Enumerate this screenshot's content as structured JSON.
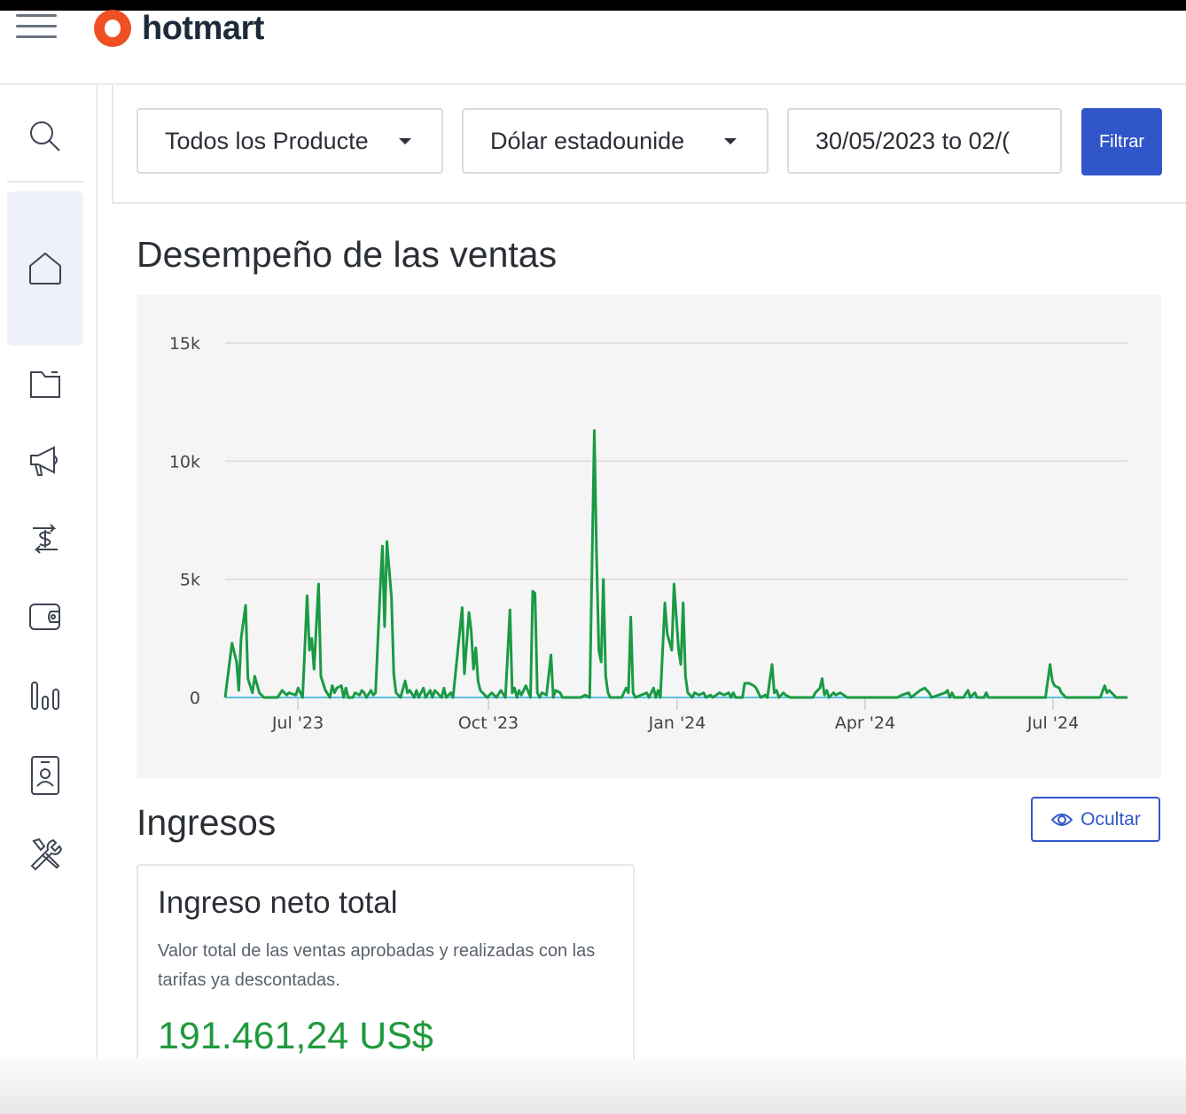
{
  "header": {
    "logo_text": "hotmart"
  },
  "sidebar": {
    "items": [
      {
        "name": "search",
        "icon": "search-icon"
      },
      {
        "name": "home",
        "icon": "home-icon",
        "active": true
      },
      {
        "name": "products",
        "icon": "folder-icon"
      },
      {
        "name": "marketing",
        "icon": "megaphone-icon"
      },
      {
        "name": "sales",
        "icon": "dollar-exchange-icon"
      },
      {
        "name": "wallet",
        "icon": "wallet-icon"
      },
      {
        "name": "analytics",
        "icon": "bar-chart-icon"
      },
      {
        "name": "contacts",
        "icon": "contact-card-icon"
      },
      {
        "name": "tools",
        "icon": "tools-icon"
      }
    ]
  },
  "filters": {
    "product_select": "Todos los Productе",
    "currency_select": "Dólar estadounide",
    "date_range": "30/05/2023 to 02/(",
    "filter_button": "Filtrar"
  },
  "sales_section": {
    "title": "Desempeño de las ventas"
  },
  "chart_data": {
    "type": "line",
    "y_tick_labels": [
      "0",
      "5k",
      "10k",
      "15k"
    ],
    "ylim": [
      0,
      15000
    ],
    "x_tick_labels": [
      "Jul '23",
      "Oct '23",
      "Jan '24",
      "Apr '24",
      "Jul '24"
    ],
    "grid": true,
    "colors": {
      "series": "#1a9a44",
      "baseline": "#5bc0de"
    },
    "series": [
      {
        "values": [
          [
            0,
            0
          ],
          [
            3,
            2300
          ],
          [
            5,
            1500
          ],
          [
            6,
            300
          ],
          [
            7,
            2500
          ],
          [
            9,
            3900
          ],
          [
            10,
            800
          ],
          [
            12,
            200
          ],
          [
            13,
            900
          ],
          [
            15,
            200
          ],
          [
            17,
            0
          ],
          [
            23,
            0
          ],
          [
            25,
            300
          ],
          [
            27,
            100
          ],
          [
            28,
            200
          ],
          [
            31,
            100
          ],
          [
            32,
            400
          ],
          [
            34,
            0
          ],
          [
            36,
            4300
          ],
          [
            37,
            2000
          ],
          [
            38,
            2500
          ],
          [
            39,
            1200
          ],
          [
            41,
            4800
          ],
          [
            42,
            900
          ],
          [
            44,
            300
          ],
          [
            46,
            0
          ],
          [
            47,
            500
          ],
          [
            48,
            200
          ],
          [
            49,
            400
          ],
          [
            51,
            500
          ],
          [
            52,
            0
          ],
          [
            53,
            400
          ],
          [
            54,
            0
          ],
          [
            56,
            0
          ],
          [
            57,
            200
          ],
          [
            59,
            100
          ],
          [
            60,
            300
          ],
          [
            61,
            200
          ],
          [
            62,
            0
          ],
          [
            64,
            300
          ],
          [
            65,
            100
          ],
          [
            66,
            200
          ],
          [
            68,
            4500
          ],
          [
            69,
            6400
          ],
          [
            70,
            3000
          ],
          [
            71,
            6600
          ],
          [
            73,
            4200
          ],
          [
            74,
            1000
          ],
          [
            75,
            200
          ],
          [
            77,
            0
          ],
          [
            79,
            700
          ],
          [
            80,
            200
          ],
          [
            81,
            300
          ],
          [
            83,
            0
          ],
          [
            84,
            300
          ],
          [
            85,
            0
          ],
          [
            87,
            400
          ],
          [
            88,
            0
          ],
          [
            90,
            300
          ],
          [
            91,
            0
          ],
          [
            92,
            300
          ],
          [
            95,
            0
          ],
          [
            96,
            400
          ],
          [
            97,
            0
          ],
          [
            99,
            200
          ],
          [
            100,
            0
          ],
          [
            104,
            3800
          ],
          [
            105,
            1000
          ],
          [
            107,
            3600
          ],
          [
            108,
            2800
          ],
          [
            109,
            1200
          ],
          [
            110,
            2100
          ],
          [
            111,
            700
          ],
          [
            112,
            300
          ],
          [
            113,
            200
          ],
          [
            115,
            0
          ],
          [
            117,
            200
          ],
          [
            119,
            0
          ],
          [
            121,
            300
          ],
          [
            123,
            0
          ],
          [
            125,
            3700
          ],
          [
            126,
            200
          ],
          [
            127,
            400
          ],
          [
            128,
            0
          ],
          [
            129,
            300
          ],
          [
            130,
            100
          ],
          [
            132,
            500
          ],
          [
            134,
            0
          ],
          [
            135,
            4500
          ],
          [
            136,
            4400
          ],
          [
            137,
            200
          ],
          [
            138,
            0
          ],
          [
            139,
            200
          ],
          [
            141,
            100
          ],
          [
            143,
            1800
          ],
          [
            144,
            0
          ],
          [
            145,
            300
          ],
          [
            147,
            200
          ],
          [
            148,
            0
          ],
          [
            156,
            0
          ],
          [
            158,
            100
          ],
          [
            160,
            0
          ],
          [
            162,
            11300
          ],
          [
            163,
            6000
          ],
          [
            164,
            2000
          ],
          [
            165,
            1500
          ],
          [
            166,
            5000
          ],
          [
            167,
            900
          ],
          [
            168,
            200
          ],
          [
            169,
            0
          ],
          [
            174,
            0
          ],
          [
            176,
            400
          ],
          [
            177,
            200
          ],
          [
            178,
            3400
          ],
          [
            179,
            200
          ],
          [
            180,
            0
          ],
          [
            185,
            200
          ],
          [
            186,
            0
          ],
          [
            188,
            400
          ],
          [
            189,
            0
          ],
          [
            190,
            300
          ],
          [
            191,
            0
          ],
          [
            193,
            4000
          ],
          [
            194,
            2700
          ],
          [
            196,
            2000
          ],
          [
            197,
            4800
          ],
          [
            199,
            2000
          ],
          [
            200,
            1400
          ],
          [
            201,
            4000
          ],
          [
            202,
            900
          ],
          [
            203,
            200
          ],
          [
            205,
            0
          ],
          [
            206,
            200
          ],
          [
            208,
            100
          ],
          [
            210,
            200
          ],
          [
            211,
            0
          ],
          [
            213,
            100
          ],
          [
            214,
            0
          ],
          [
            217,
            200
          ],
          [
            219,
            100
          ],
          [
            221,
            200
          ],
          [
            222,
            0
          ],
          [
            223,
            200
          ],
          [
            224,
            0
          ],
          [
            227,
            0
          ],
          [
            228,
            600
          ],
          [
            230,
            600
          ],
          [
            232,
            500
          ],
          [
            233,
            400
          ],
          [
            235,
            0
          ],
          [
            237,
            100
          ],
          [
            238,
            0
          ],
          [
            240,
            1400
          ],
          [
            241,
            200
          ],
          [
            242,
            300
          ],
          [
            243,
            0
          ],
          [
            245,
            200
          ],
          [
            246,
            100
          ],
          [
            248,
            0
          ],
          [
            258,
            0
          ],
          [
            259,
            200
          ],
          [
            261,
            400
          ],
          [
            262,
            800
          ],
          [
            263,
            100
          ],
          [
            264,
            300
          ],
          [
            265,
            0
          ],
          [
            267,
            200
          ],
          [
            268,
            100
          ],
          [
            270,
            200
          ],
          [
            273,
            0
          ],
          [
            295,
            0
          ],
          [
            297,
            100
          ],
          [
            300,
            200
          ],
          [
            301,
            0
          ],
          [
            305,
            300
          ],
          [
            307,
            400
          ],
          [
            309,
            200
          ],
          [
            310,
            0
          ],
          [
            316,
            200
          ],
          [
            317,
            300
          ],
          [
            318,
            0
          ],
          [
            319,
            200
          ],
          [
            320,
            0
          ],
          [
            324,
            0
          ],
          [
            326,
            300
          ],
          [
            327,
            0
          ],
          [
            329,
            200
          ],
          [
            330,
            0
          ],
          [
            333,
            0
          ],
          [
            334,
            200
          ],
          [
            335,
            0
          ],
          [
            360,
            0
          ],
          [
            362,
            1400
          ],
          [
            363,
            700
          ],
          [
            364,
            500
          ],
          [
            366,
            400
          ],
          [
            367,
            200
          ],
          [
            369,
            0
          ],
          [
            384,
            0
          ],
          [
            386,
            500
          ],
          [
            387,
            200
          ],
          [
            388,
            300
          ],
          [
            390,
            100
          ],
          [
            391,
            0
          ],
          [
            396,
            0
          ]
        ]
      }
    ]
  },
  "income_section": {
    "title": "Ingresos",
    "hide_button": "Ocultar",
    "card": {
      "title": "Ingreso neto total",
      "description": "Valor total de las ventas aprobadas y realizadas con las tarifas ya descontadas.",
      "value": "191.461,24 US$"
    }
  }
}
